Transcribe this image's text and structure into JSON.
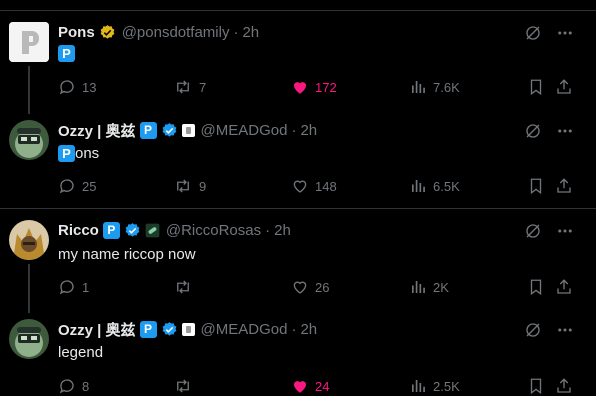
{
  "colors": {
    "background": "#000000",
    "text": "#e7e9ea",
    "muted": "#71767b",
    "accent": "#1d9bf0",
    "like": "#f91880",
    "verified_gold": "#e2b719"
  },
  "tweets": [
    {
      "name": "Pons",
      "verified": "gold",
      "handle": "@ponsdotfamily",
      "time": "2h",
      "text": "🅿",
      "text_icon": "p-badge-icon",
      "reply_count": "13",
      "retweet_count": "7",
      "like_count": "172",
      "liked": true,
      "view_count": "7.6K"
    },
    {
      "name": "Ozzy | 奥兹",
      "name_badge": "P",
      "verified": "blue",
      "affiliate_icon": "affiliate-logo-icon",
      "handle": "@MEADGod",
      "time": "2h",
      "text": "ons",
      "text_prefix_badge": "P",
      "reply_count": "25",
      "retweet_count": "9",
      "like_count": "148",
      "liked": false,
      "view_count": "6.5K"
    },
    {
      "name": "Ricco",
      "name_badge": "P",
      "verified": "blue",
      "affiliate_icon": "pill-icon",
      "handle": "@RiccoRosas",
      "time": "2h",
      "text": "my name riccop now",
      "reply_count": "1",
      "retweet_count": "",
      "like_count": "26",
      "liked": false,
      "view_count": "2K"
    },
    {
      "name": "Ozzy | 奥兹",
      "name_badge": "P",
      "verified": "blue",
      "affiliate_icon": "affiliate-logo-icon",
      "handle": "@MEADGod",
      "time": "2h",
      "text": "legend",
      "reply_count": "8",
      "retweet_count": "",
      "like_count": "24",
      "liked": true,
      "view_count": "2.5K"
    }
  ],
  "separator": "·"
}
